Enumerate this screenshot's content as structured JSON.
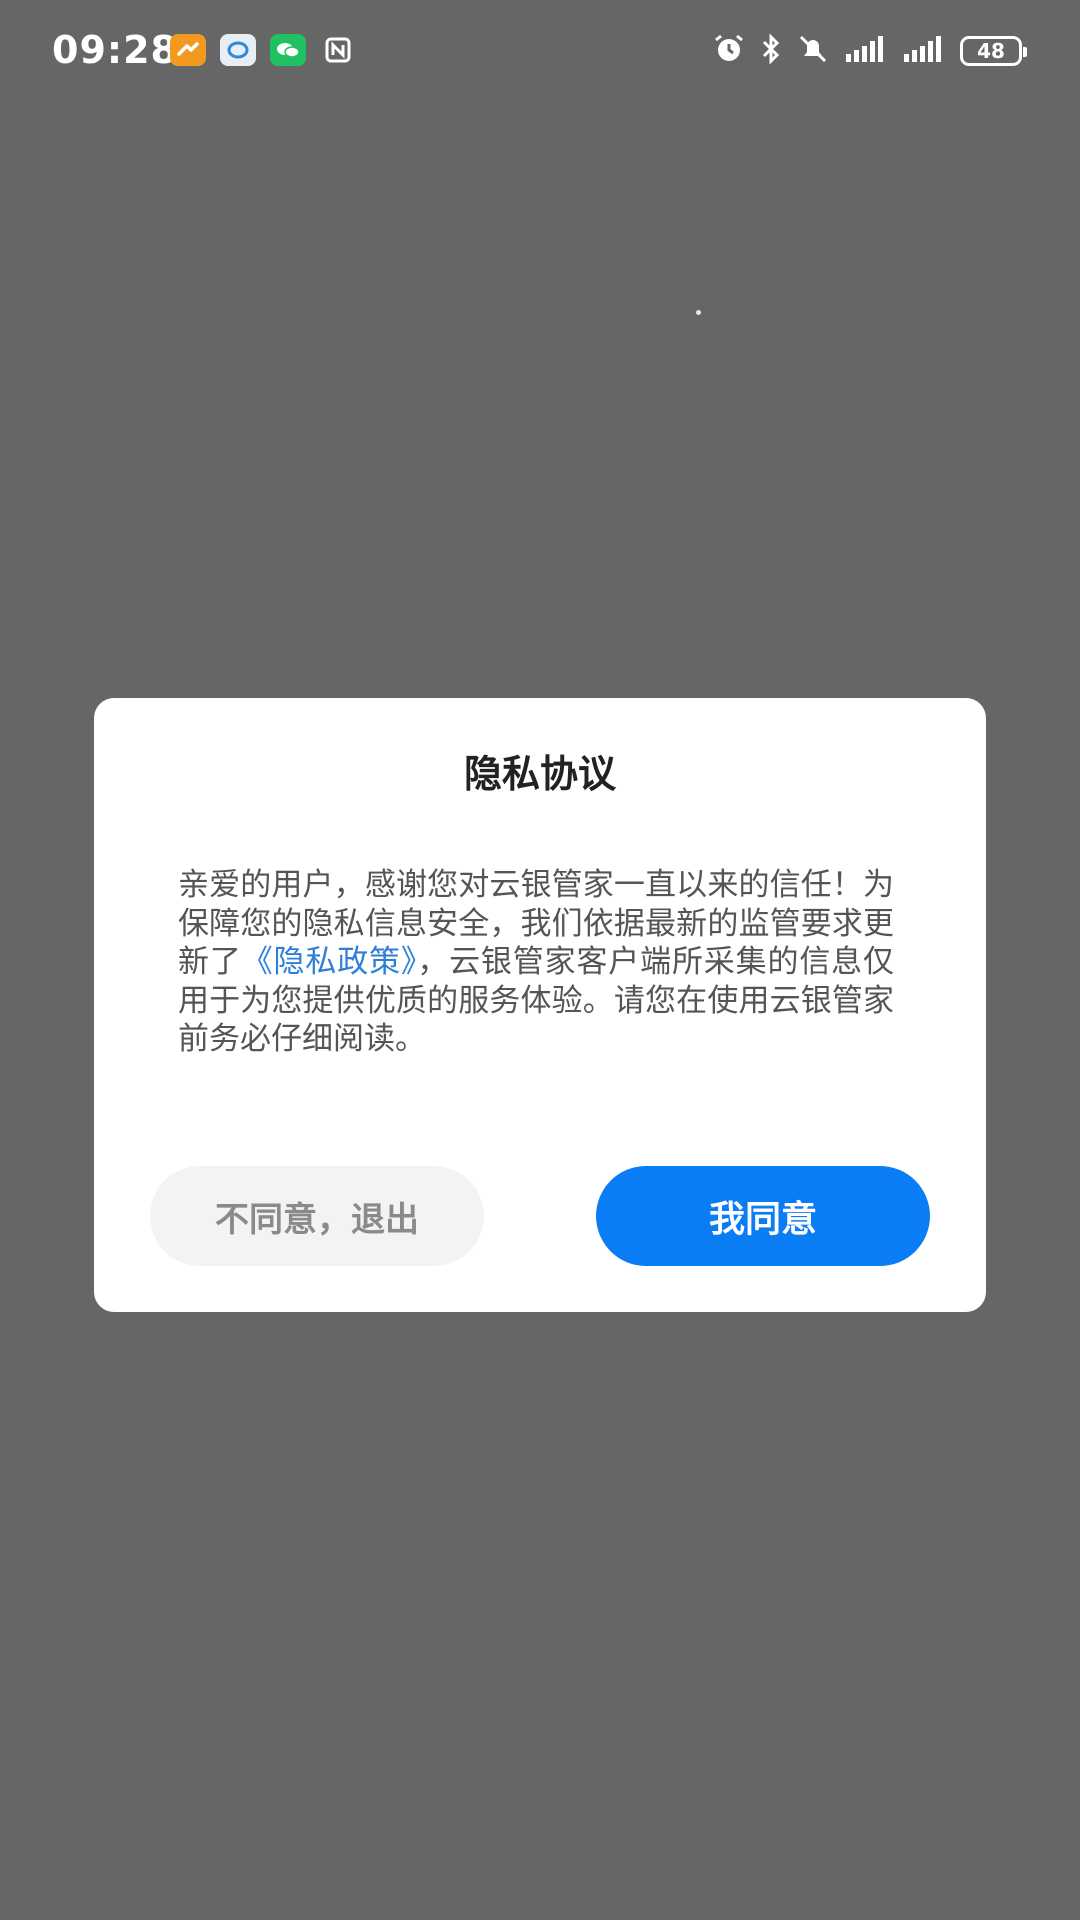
{
  "status_bar": {
    "time": "09:28",
    "battery": "48",
    "notification_icons": [
      "orange-app-icon",
      "bubble-app-icon",
      "wechat-icon",
      "nfc-icon"
    ],
    "system_icons": [
      "alarm-icon",
      "bluetooth-icon",
      "mute-icon",
      "signal-icon",
      "signal-icon"
    ]
  },
  "dialog": {
    "title": "隐私协议",
    "body_part1": "亲爱的用户，感谢您对云银管家一直以来的信任！为保障您的隐私信息安全，我们依据最新的监管要求更新了",
    "policy_link": "《隐私政策》",
    "body_part2": "，云银管家客户端所采集的信息仅用于为您提供优质的服务体验。请您在使用云银管家前务必仔细阅读。",
    "disagree_label": "不同意，退出",
    "agree_label": "我同意"
  },
  "colors": {
    "overlay_background": "#666666",
    "dialog_background": "#ffffff",
    "primary_button": "#0a7cf4",
    "link": "#2f7fd8"
  }
}
